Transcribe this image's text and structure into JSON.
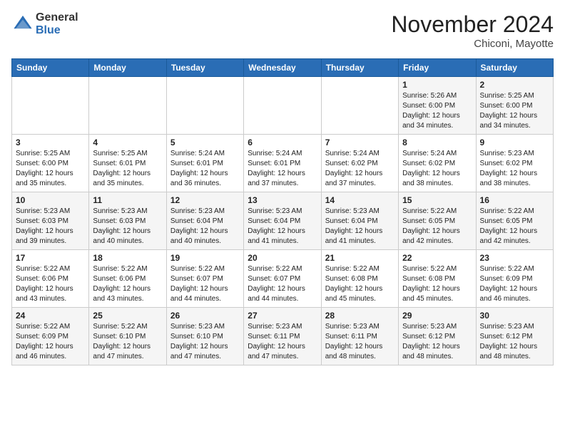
{
  "header": {
    "logo_line1": "General",
    "logo_line2": "Blue",
    "month_title": "November 2024",
    "location": "Chiconi, Mayotte"
  },
  "weekdays": [
    "Sunday",
    "Monday",
    "Tuesday",
    "Wednesday",
    "Thursday",
    "Friday",
    "Saturday"
  ],
  "weeks": [
    [
      {
        "day": "",
        "info": ""
      },
      {
        "day": "",
        "info": ""
      },
      {
        "day": "",
        "info": ""
      },
      {
        "day": "",
        "info": ""
      },
      {
        "day": "",
        "info": ""
      },
      {
        "day": "1",
        "info": "Sunrise: 5:26 AM\nSunset: 6:00 PM\nDaylight: 12 hours\nand 34 minutes."
      },
      {
        "day": "2",
        "info": "Sunrise: 5:25 AM\nSunset: 6:00 PM\nDaylight: 12 hours\nand 34 minutes."
      }
    ],
    [
      {
        "day": "3",
        "info": "Sunrise: 5:25 AM\nSunset: 6:00 PM\nDaylight: 12 hours\nand 35 minutes."
      },
      {
        "day": "4",
        "info": "Sunrise: 5:25 AM\nSunset: 6:01 PM\nDaylight: 12 hours\nand 35 minutes."
      },
      {
        "day": "5",
        "info": "Sunrise: 5:24 AM\nSunset: 6:01 PM\nDaylight: 12 hours\nand 36 minutes."
      },
      {
        "day": "6",
        "info": "Sunrise: 5:24 AM\nSunset: 6:01 PM\nDaylight: 12 hours\nand 37 minutes."
      },
      {
        "day": "7",
        "info": "Sunrise: 5:24 AM\nSunset: 6:02 PM\nDaylight: 12 hours\nand 37 minutes."
      },
      {
        "day": "8",
        "info": "Sunrise: 5:24 AM\nSunset: 6:02 PM\nDaylight: 12 hours\nand 38 minutes."
      },
      {
        "day": "9",
        "info": "Sunrise: 5:23 AM\nSunset: 6:02 PM\nDaylight: 12 hours\nand 38 minutes."
      }
    ],
    [
      {
        "day": "10",
        "info": "Sunrise: 5:23 AM\nSunset: 6:03 PM\nDaylight: 12 hours\nand 39 minutes."
      },
      {
        "day": "11",
        "info": "Sunrise: 5:23 AM\nSunset: 6:03 PM\nDaylight: 12 hours\nand 40 minutes."
      },
      {
        "day": "12",
        "info": "Sunrise: 5:23 AM\nSunset: 6:04 PM\nDaylight: 12 hours\nand 40 minutes."
      },
      {
        "day": "13",
        "info": "Sunrise: 5:23 AM\nSunset: 6:04 PM\nDaylight: 12 hours\nand 41 minutes."
      },
      {
        "day": "14",
        "info": "Sunrise: 5:23 AM\nSunset: 6:04 PM\nDaylight: 12 hours\nand 41 minutes."
      },
      {
        "day": "15",
        "info": "Sunrise: 5:22 AM\nSunset: 6:05 PM\nDaylight: 12 hours\nand 42 minutes."
      },
      {
        "day": "16",
        "info": "Sunrise: 5:22 AM\nSunset: 6:05 PM\nDaylight: 12 hours\nand 42 minutes."
      }
    ],
    [
      {
        "day": "17",
        "info": "Sunrise: 5:22 AM\nSunset: 6:06 PM\nDaylight: 12 hours\nand 43 minutes."
      },
      {
        "day": "18",
        "info": "Sunrise: 5:22 AM\nSunset: 6:06 PM\nDaylight: 12 hours\nand 43 minutes."
      },
      {
        "day": "19",
        "info": "Sunrise: 5:22 AM\nSunset: 6:07 PM\nDaylight: 12 hours\nand 44 minutes."
      },
      {
        "day": "20",
        "info": "Sunrise: 5:22 AM\nSunset: 6:07 PM\nDaylight: 12 hours\nand 44 minutes."
      },
      {
        "day": "21",
        "info": "Sunrise: 5:22 AM\nSunset: 6:08 PM\nDaylight: 12 hours\nand 45 minutes."
      },
      {
        "day": "22",
        "info": "Sunrise: 5:22 AM\nSunset: 6:08 PM\nDaylight: 12 hours\nand 45 minutes."
      },
      {
        "day": "23",
        "info": "Sunrise: 5:22 AM\nSunset: 6:09 PM\nDaylight: 12 hours\nand 46 minutes."
      }
    ],
    [
      {
        "day": "24",
        "info": "Sunrise: 5:22 AM\nSunset: 6:09 PM\nDaylight: 12 hours\nand 46 minutes."
      },
      {
        "day": "25",
        "info": "Sunrise: 5:22 AM\nSunset: 6:10 PM\nDaylight: 12 hours\nand 47 minutes."
      },
      {
        "day": "26",
        "info": "Sunrise: 5:23 AM\nSunset: 6:10 PM\nDaylight: 12 hours\nand 47 minutes."
      },
      {
        "day": "27",
        "info": "Sunrise: 5:23 AM\nSunset: 6:11 PM\nDaylight: 12 hours\nand 47 minutes."
      },
      {
        "day": "28",
        "info": "Sunrise: 5:23 AM\nSunset: 6:11 PM\nDaylight: 12 hours\nand 48 minutes."
      },
      {
        "day": "29",
        "info": "Sunrise: 5:23 AM\nSunset: 6:12 PM\nDaylight: 12 hours\nand 48 minutes."
      },
      {
        "day": "30",
        "info": "Sunrise: 5:23 AM\nSunset: 6:12 PM\nDaylight: 12 hours\nand 48 minutes."
      }
    ]
  ]
}
